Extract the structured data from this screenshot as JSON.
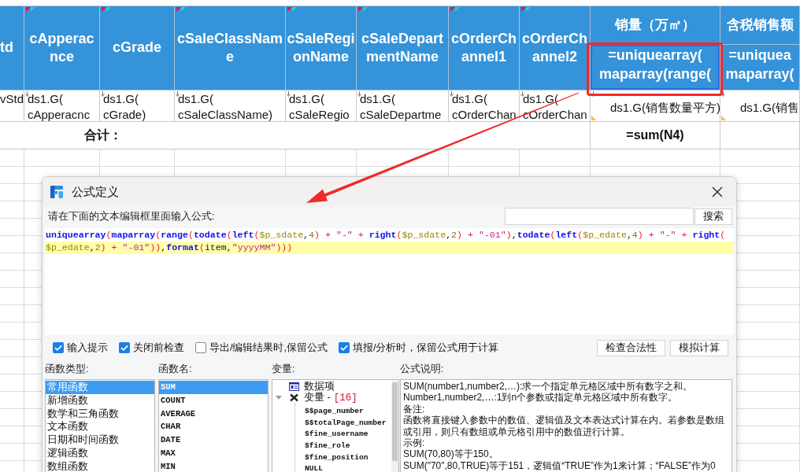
{
  "sheet": {
    "columns": [
      {
        "header": [
          "td"
        ],
        "flag": false,
        "cell": [
          "vStd"
        ],
        "expand_marker": false,
        "corner_triangle": false
      },
      {
        "header": [
          "cApperac",
          "nce"
        ],
        "flag": true,
        "cell": [
          "ds1.G(",
          "cApperacnc"
        ],
        "expand_marker": true,
        "corner_triangle": false
      },
      {
        "header": [
          "cGrade"
        ],
        "flag": true,
        "cell": [
          "ds1.G(",
          "cGrade)"
        ],
        "expand_marker": true,
        "corner_triangle": false
      },
      {
        "header": [
          "cSaleClassNam",
          "e"
        ],
        "flag": true,
        "cell": [
          "ds1.G(",
          "cSaleClassName)"
        ],
        "expand_marker": true,
        "corner_triangle": false
      },
      {
        "header": [
          "cSaleRegi",
          "onName"
        ],
        "flag": true,
        "cell": [
          "ds1.G(",
          "cSaleRegio"
        ],
        "expand_marker": true,
        "corner_triangle": false
      },
      {
        "header": [
          "cSaleDepart",
          "mentName"
        ],
        "flag": true,
        "cell": [
          "ds1.G(",
          "cSaleDepartme"
        ],
        "expand_marker": true,
        "corner_triangle": false
      },
      {
        "header": [
          "cOrderCh",
          "annel1"
        ],
        "flag": true,
        "cell": [
          "ds1.G(",
          "cOrderChan"
        ],
        "expand_marker": true,
        "corner_triangle": false
      },
      {
        "header": [
          "cOrderCh",
          "annel2"
        ],
        "flag": true,
        "cell": [
          "ds1.G(",
          "cOrderChan"
        ],
        "expand_marker": true,
        "corner_triangle": false
      },
      {
        "header": [
          "销量（万㎡）"
        ],
        "flag": false,
        "subheader": {
          "lines": [
            "=uniquearray(",
            "maparray(range("
          ],
          "marker": true,
          "selected": true
        },
        "cell": [
          "ds1.G(销售数量平方)"
        ],
        "expand_marker": true,
        "corner_triangle": true,
        "total": "=sum(N4)"
      },
      {
        "header": [
          "含税销售额"
        ],
        "flag": false,
        "subheader": {
          "lines": [
            "=uniquea",
            "maparray("
          ],
          "marker": false,
          "selected": false
        },
        "cell": [
          "ds1.G(销售"
        ],
        "expand_marker": true,
        "corner_triangle": true
      }
    ],
    "total_label": "合计："
  },
  "dialog": {
    "title": "公式定义",
    "prompt": "请在下面的文本编辑框里面输入公式:",
    "search_button": "搜索",
    "editor": {
      "lines": [
        {
          "text": "uniquearray(maparray(range(todate(left($p_sdate,4) + \"-\" + right($p_sdate,2) + \"-01\"),todate(left($p_edate,4) + \"-\" + right(",
          "highlighted": false
        },
        {
          "text": "$p_edate,2) + \"-01\")),format(item,\"yyyyMM\")))",
          "highlighted": true
        }
      ]
    },
    "options": [
      {
        "label": "输入提示",
        "checked": true
      },
      {
        "label": "关闭前检查",
        "checked": true
      },
      {
        "label": "导出/编辑结果时,保留公式",
        "checked": false
      },
      {
        "label": "填报/分析时，保留公式用于计算",
        "checked": true
      }
    ],
    "actions": [
      "检查合法性",
      "模拟计算"
    ],
    "function_types": {
      "label": "函数类型:",
      "items": [
        {
          "label": "常用函数",
          "selected": true
        },
        {
          "label": "新增函数",
          "selected": false
        },
        {
          "label": "数学和三角函数",
          "selected": false
        },
        {
          "label": "文本函数",
          "selected": false
        },
        {
          "label": "日期和时间函数",
          "selected": false
        },
        {
          "label": "逻辑函数",
          "selected": false
        },
        {
          "label": "数组函数",
          "selected": false
        }
      ]
    },
    "function_names": {
      "label": "函数名:",
      "items": [
        {
          "label": "SUM",
          "selected": true
        },
        {
          "label": "COUNT",
          "selected": false
        },
        {
          "label": "AVERAGE",
          "selected": false
        },
        {
          "label": "CHAR",
          "selected": false
        },
        {
          "label": "DATE",
          "selected": false
        },
        {
          "label": "MAX",
          "selected": false
        },
        {
          "label": "MIN",
          "selected": false
        }
      ]
    },
    "variables": {
      "label": "变量:",
      "items": [
        {
          "label": "数据项",
          "kind": "data"
        },
        {
          "label": "变量 -",
          "count": "[16]",
          "kind": "group",
          "expanded": true,
          "children": [
            {
              "label": "$$page_number"
            },
            {
              "label": "$$totalPage_number"
            },
            {
              "label": "$fine_username"
            },
            {
              "label": "$fine_role"
            },
            {
              "label": "$fine_position"
            },
            {
              "label": "NULL"
            }
          ]
        }
      ]
    },
    "description": {
      "label": "公式说明:",
      "paragraphs": [
        "SUM(number1,number2,…):求一个指定单元格区域中所有数字之和。",
        "Number1,number2,…:1到n个参数或指定单元格区域中所有数字。",
        "备注:",
        "函数将直接键入参数中的数值、逻辑值及文本表达式计算在内。若参数是数组或引用，则只有数组或单元格引用中的数值进行计算。",
        "示例:",
        "SUM(70,80)等于150。",
        "SUM(\"70\",80,TRUE)等于151，逻辑值“TRUE”作为1来计算；“FALSE”作为0"
      ]
    }
  }
}
